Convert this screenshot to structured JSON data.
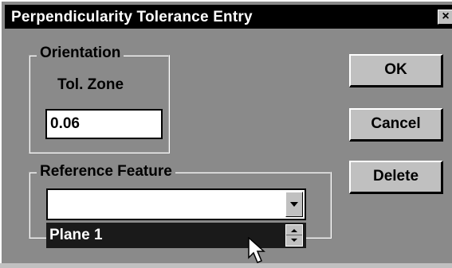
{
  "window": {
    "title": "Perpendicularity Tolerance Entry",
    "close_glyph": "×"
  },
  "orientation": {
    "legend": "Orientation",
    "tol_zone_label": "Tol. Zone",
    "tol_zone_value": "0.06"
  },
  "reference": {
    "legend": "Reference Feature",
    "combo_value": "",
    "list_item": "Plane 1"
  },
  "buttons": {
    "ok": "OK",
    "cancel": "Cancel",
    "delete": "Delete"
  },
  "icons": {
    "combo_arrow": "dropdown-arrow-icon",
    "spinner": "spinner-icon",
    "cursor": "mouse-pointer-icon"
  },
  "colors": {
    "dialog_bg": "#8a8a8a",
    "titlebar_bg": "#000000",
    "selection_bg": "#1a1a1a"
  }
}
